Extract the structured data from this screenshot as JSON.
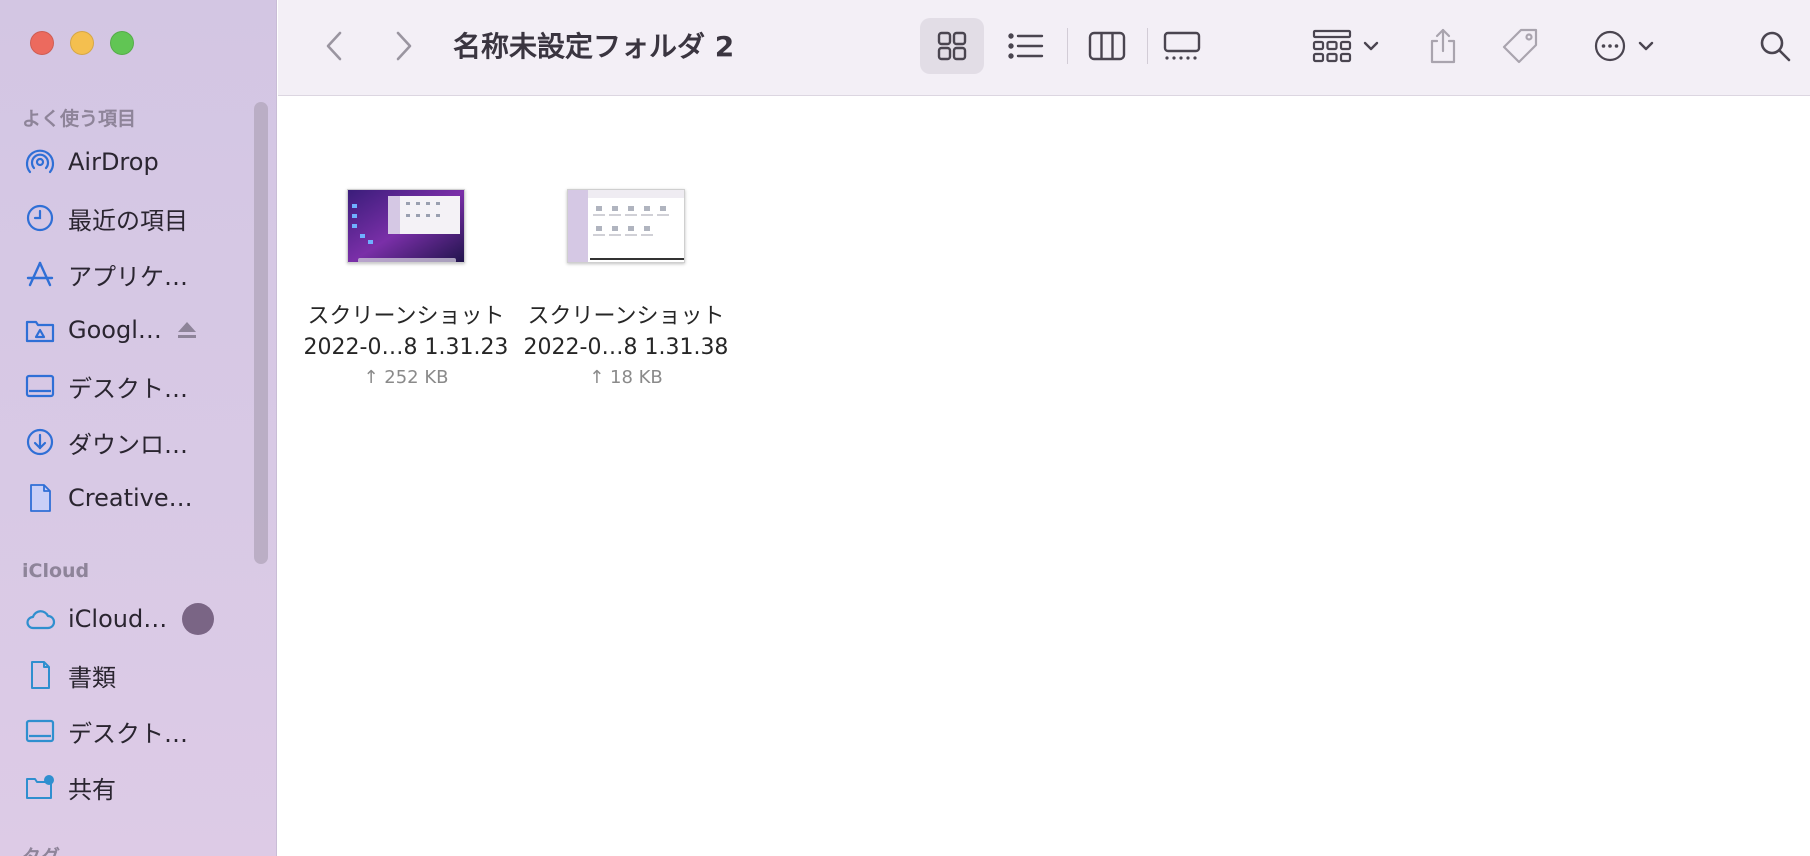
{
  "window": {
    "title": "名称未設定フォルダ 2"
  },
  "sidebar": {
    "favorites_header": "よく使う項目",
    "favorites": [
      {
        "label": "AirDrop",
        "icon": "airdrop-icon"
      },
      {
        "label": "最近の項目",
        "icon": "clock-icon"
      },
      {
        "label": "アプリケ…",
        "icon": "applications-icon"
      },
      {
        "label": "Googl…",
        "icon": "google-drive-folder-icon"
      },
      {
        "label": "デスクト…",
        "icon": "desktop-icon"
      },
      {
        "label": "ダウンロ…",
        "icon": "download-icon"
      },
      {
        "label": "Creative…",
        "icon": "document-icon"
      }
    ],
    "icloud_header": "iCloud",
    "icloud": [
      {
        "label": "iCloud…",
        "icon": "cloud-icon"
      },
      {
        "label": "書類",
        "icon": "document-icon"
      },
      {
        "label": "デスクト…",
        "icon": "desktop-icon"
      },
      {
        "label": "共有",
        "icon": "shared-folder-icon"
      }
    ],
    "tags_header": "タグ"
  },
  "files": [
    {
      "name_line1": "スクリーンショット",
      "name_line2": "2022-0…8 1.31.23",
      "size": "↑ 252 KB"
    },
    {
      "name_line1": "スクリーンショット",
      "name_line2": "2022-0…8 1.31.38",
      "size": "↑ 18 KB"
    }
  ],
  "colors": {
    "accent": "#2f6fd6",
    "sidebar_bg": "#d5c8e4",
    "icloud_badge": "#7a6585"
  }
}
